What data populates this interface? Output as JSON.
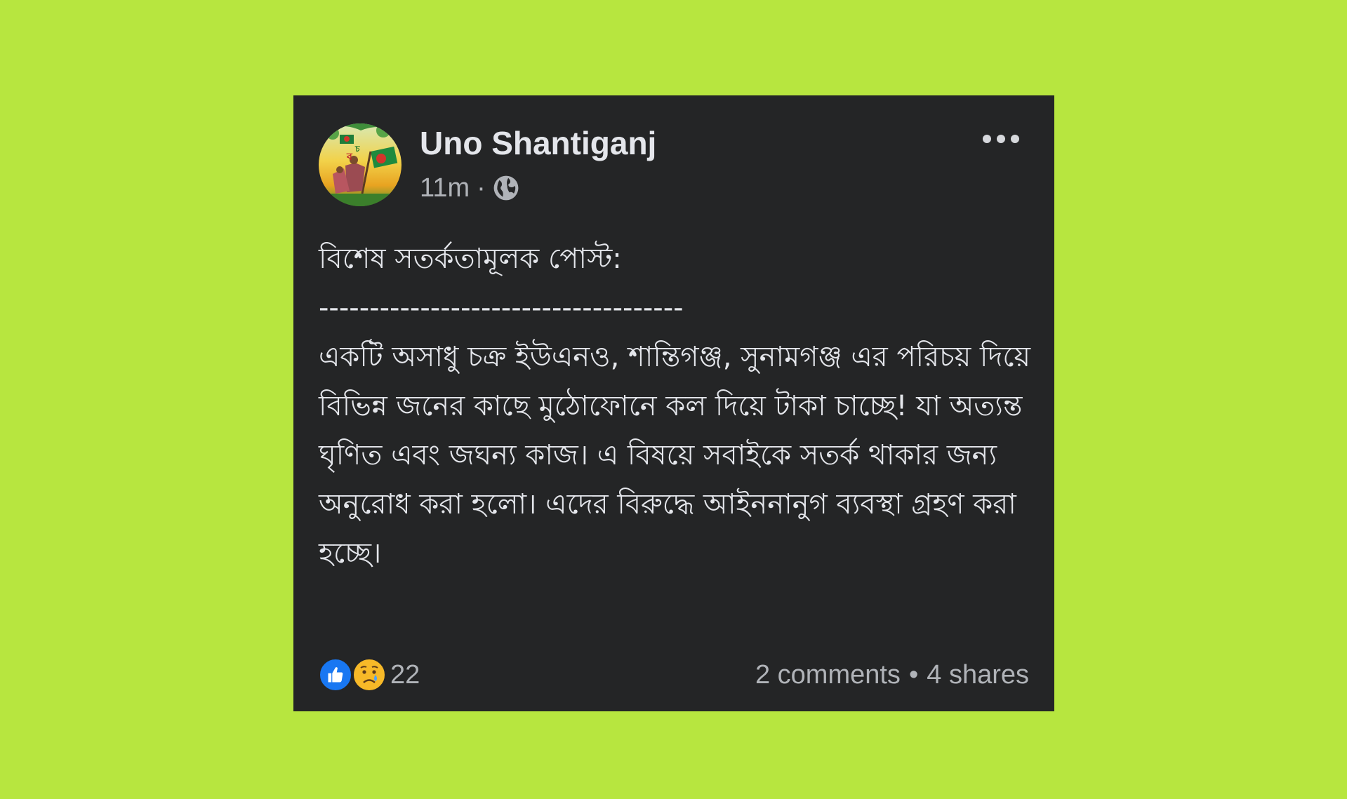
{
  "colors": {
    "page_background": "#b7e63f",
    "card_background": "#242526",
    "primary_text": "#e4e6eb",
    "secondary_text": "#b0b3b8",
    "like_blue": "#1877f2",
    "sad_yellow": "#f7b928"
  },
  "post": {
    "author": "Uno Shantiganj",
    "time": "11m",
    "separator": "·",
    "privacy_icon": "globe-icon",
    "more_icon": "more-options-icon",
    "title": "বিশেষ সতর্কতামূলক পোস্ট:",
    "divider": "------------------------------------",
    "body": "একটি অসাধু চক্র ইউএনও, শান্তিগঞ্জ, সুনামগঞ্জ এর পরিচয় দিয়ে বিভিন্ন জনের কাছে মুঠোফোনে কল দিয়ে টাকা চাচ্ছে! যা অত্যন্ত ঘৃণিত এবং জঘন্য কাজ। এ বিষয়ে সবাইকে সতর্ক থাকার জন্য অনুরোধ করা হলো।  এদের বিরুদ্ধে আইননানুগ ব্যবস্থা গ্রহণ করা হচ্ছে।"
  },
  "footer": {
    "reactions": [
      "like-icon",
      "sad-icon"
    ],
    "reaction_count": "22",
    "comments": "2 comments",
    "bullet": "•",
    "shares": "4 shares"
  }
}
